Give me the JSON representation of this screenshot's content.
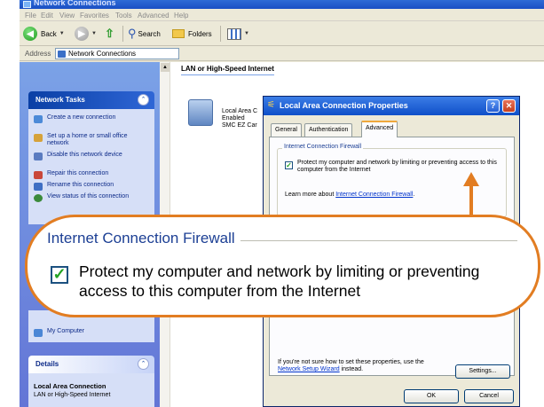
{
  "window": {
    "title": "Network Connections"
  },
  "menu": [
    "File",
    "Edit",
    "View",
    "Favorites",
    "Tools",
    "Advanced",
    "Help"
  ],
  "toolbar": {
    "back": "Back",
    "search": "Search",
    "folders": "Folders"
  },
  "address": {
    "label": "Address",
    "value": "Network Connections"
  },
  "network_tasks": {
    "title": "Network Tasks",
    "items": [
      {
        "label": "Create a new connection",
        "icon": "new-connection-icon"
      },
      {
        "label": "Set up a home or small office network",
        "icon": "home-network-icon"
      },
      {
        "label": "Disable this network device",
        "icon": "disable-device-icon"
      },
      {
        "label": "Repair this connection",
        "icon": "repair-icon"
      },
      {
        "label": "Rename this connection",
        "icon": "rename-icon"
      },
      {
        "label": "View status of this connection",
        "icon": "status-icon"
      }
    ]
  },
  "other_places": {
    "my_computer": "My Computer"
  },
  "details": {
    "title": "Details",
    "name": "Local Area Connection",
    "type": "LAN or High-Speed Internet"
  },
  "content": {
    "group_title": "LAN or High-Speed Internet",
    "connection": {
      "line1": "Local Area C",
      "line2": "Enabled",
      "line3": "SMC EZ Car"
    }
  },
  "dialog": {
    "title": "Local Area Connection Properties",
    "tabs": [
      "General",
      "Authentication",
      "Advanced"
    ],
    "active_tab": "Advanced",
    "firewall": {
      "group_title": "Internet Connection Firewall",
      "checkbox_label": "Protect my computer and network by limiting or preventing access to this computer from the Internet",
      "learn_prefix": "Learn more about ",
      "learn_link": "Internet Connection Firewall",
      "learn_suffix": "."
    },
    "help_text_before": "If you're not sure how to set these properties, use the ",
    "help_link": "Network Setup Wizard",
    "help_text_after": " instead.",
    "settings_button": "Settings...",
    "ok_button": "OK",
    "cancel_button": "Cancel"
  },
  "callout": {
    "title": "Internet Connection Firewall",
    "checkbox_text": "Protect my computer and network by limiting or preventing access to this computer from the Internet"
  },
  "accent_color": "#e27d22"
}
